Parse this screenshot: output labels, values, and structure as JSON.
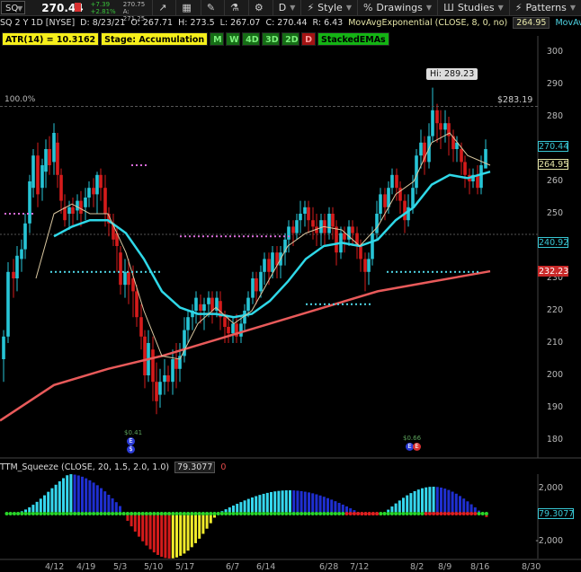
{
  "toolbar": {
    "symbol": "SQ",
    "price": "270.44",
    "change_abs": "+7.39",
    "change_pct": "+2.81%",
    "bid": "B: 270.75",
    "ask": "A: 271.25",
    "buttons": [
      {
        "name": "share",
        "icon": "↗",
        "label": ""
      },
      {
        "name": "grid",
        "icon": "▦",
        "label": ""
      },
      {
        "name": "drawing-tool",
        "icon": "✎",
        "label": ""
      },
      {
        "name": "flask",
        "icon": "⚗",
        "label": ""
      },
      {
        "name": "settings",
        "icon": "⚙",
        "label": ""
      },
      {
        "name": "period",
        "icon": "",
        "label": "D"
      },
      {
        "name": "style",
        "icon": "⚡",
        "label": "Style"
      },
      {
        "name": "drawings",
        "icon": "%",
        "label": "Drawings"
      },
      {
        "name": "studies",
        "icon": "Ш",
        "label": "Studies"
      },
      {
        "name": "patterns",
        "icon": "⚡",
        "label": "Patterns"
      }
    ]
  },
  "info_row": {
    "title": "SQ 2 Y 1D [NYSE]",
    "date": "D: 8/23/21",
    "open": "O: 267.71",
    "high": "H: 273.5",
    "low": "L: 267.07",
    "close": "C: 270.44",
    "range": "R: 6.43",
    "ema_study": "MovAvgExponential (CLOSE, 8, 0, no)",
    "ema_value": "264.95",
    "ema_study2": "MovAvg..."
  },
  "badges": {
    "atr": "ATR(14) = 10.3162",
    "stage": "Stage: Accumulation",
    "m": "M",
    "w": "W",
    "d4": "4D",
    "d3": "3D",
    "d2": "2D",
    "d": "D",
    "stacked": "StackedEMAs"
  },
  "price_axis": [
    "300",
    "290",
    "280",
    "270",
    "260",
    "250",
    "240",
    "230",
    "220",
    "210",
    "200",
    "190",
    "180"
  ],
  "tags": {
    "last": "270.44",
    "ema8": "264.95",
    "level": "240.92",
    "sma": "232.23",
    "hi": "Hi: 289.23",
    "pct": "100.0%",
    "p283": "$283.19"
  },
  "colors": {
    "up": "#27c5d6",
    "down": "#d61b1b",
    "ema8": "#d9c7a0",
    "ema21": "#2fd8e8",
    "sma": "#e85a5a",
    "magenta": "#d86bd8",
    "cyan_dots": "#4fd6e6"
  },
  "events": {
    "e1_label": "$0.41",
    "e2_label": "$0.66"
  },
  "lower_panel": {
    "title": "TTM_Squeeze (CLOSE, 20, 1.5, 2.0, 1.0)",
    "value": "79.3077",
    "zero": "0",
    "axis": [
      "2,000",
      "0",
      "-2,000"
    ],
    "tag": "79.3077"
  },
  "dates": [
    "4/12",
    "4/19",
    "5/3",
    "5/10",
    "5/17",
    "6/7",
    "6/14",
    "6/28",
    "7/12",
    "8/2",
    "8/9",
    "8/16",
    "8/30"
  ]
}
